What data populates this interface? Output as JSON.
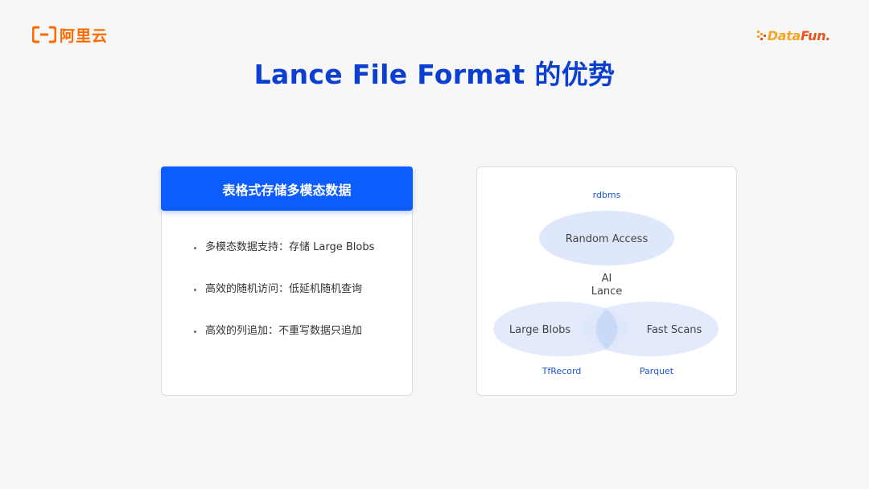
{
  "logos": {
    "left_text": "阿里云",
    "right_text_1": "Data",
    "right_text_2": "Fun."
  },
  "title": "Lance File Format 的优势",
  "left_card": {
    "header": "表格式存储多模态数据",
    "bullets": [
      "多模态数据支持：存储 Large Blobs",
      "高效的随机访问：低延机随机查询",
      "高效的列追加：不重写数据只追加"
    ]
  },
  "diagram": {
    "top_label": "rdbms",
    "top_circle": "Random Access",
    "center_line1": "AI",
    "center_line2": "Lance",
    "left_circle": "Large Blobs",
    "right_circle": "Fast Scans",
    "left_label": "TfRecord",
    "right_label": "Parquet"
  },
  "colors": {
    "title": "#0b3fd1",
    "header_bg": "#0c5cff",
    "ellipse_fill": "#dfe8fb",
    "brand_orange": "#ff6a00"
  }
}
